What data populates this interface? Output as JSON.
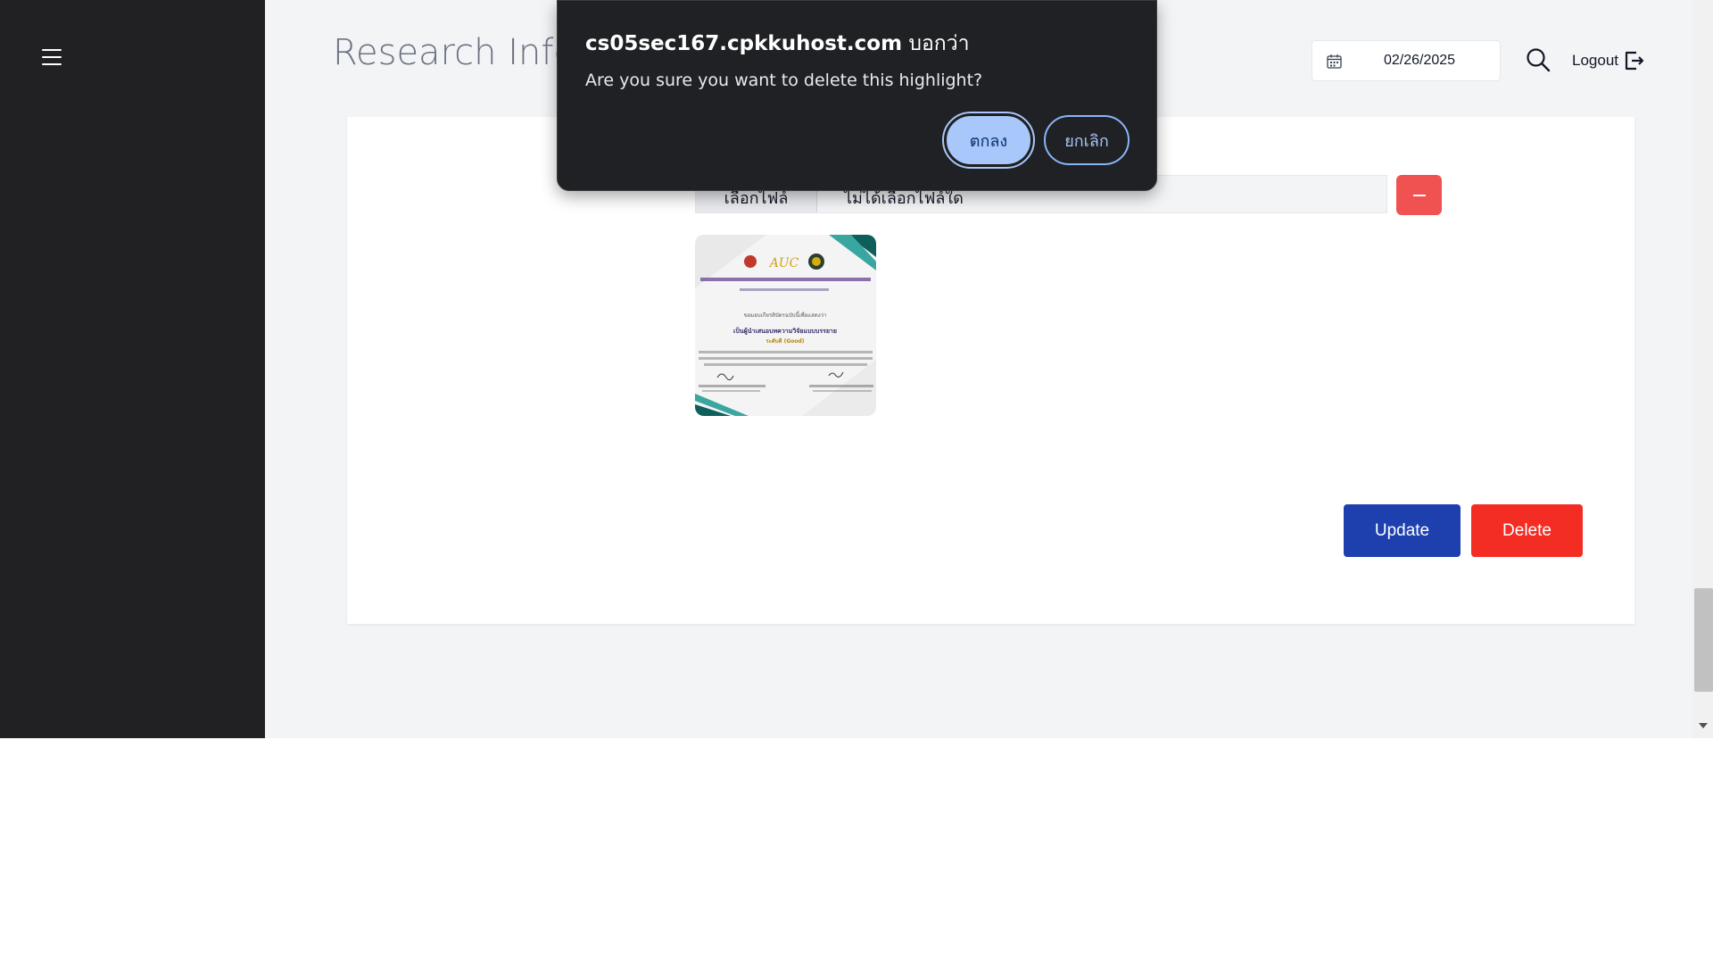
{
  "header": {
    "page_title": "Research Infor",
    "date_value": "02/26/2025",
    "logout_label": "Logout"
  },
  "form": {
    "file_button_label": "เลือกไฟล์",
    "file_status": "ไม่ได้เลือกไฟล์ใด",
    "update_label": "Update",
    "delete_label": "Delete"
  },
  "thumbnail": {
    "logo_text": "AUC",
    "line1": "ขอมอบเกียรติบัตรฉบับนี้เพื่อแสดงว่า",
    "line2": "เป็นผู้นำเสนอบทความวิจัยแบบบรรยาย",
    "award": "ระดับดี (Good)"
  },
  "dialog": {
    "domain": "cs05sec167.cpkkuhost.com",
    "suffix": " บอกว่า",
    "message": "Are you sure you want to delete this highlight?",
    "ok_label": "ตกลง",
    "cancel_label": "ยกเลิก"
  },
  "icons": {
    "menu": "hamburger-icon",
    "calendar": "calendar-icon",
    "search": "search-icon",
    "logout": "logout-icon",
    "remove": "minus-icon"
  },
  "colors": {
    "sidebar": "#212124",
    "update_button": "#1e40af",
    "delete_button": "#f32d23",
    "remove_button": "#f05252",
    "dialog_bg": "#202124",
    "dialog_ok": "#a8c7fa"
  }
}
